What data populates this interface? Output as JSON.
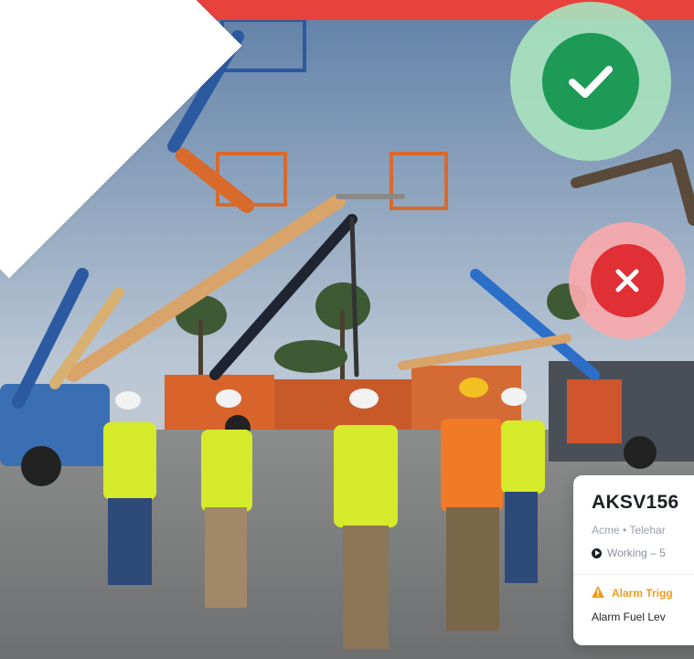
{
  "card": {
    "title": "AKSV156",
    "subtitle": "Acme • Telehar",
    "status": "Working – 5",
    "alarm_title": "Alarm Trigg",
    "alarm_detail": "Alarm Fuel Lev"
  },
  "colors": {
    "brand_red": "#e8423c",
    "success_green": "#1e9a57",
    "error_red": "#e02f35",
    "alarm_orange": "#f29a1c"
  },
  "icons": {
    "ok_badge": "checkmark-icon",
    "fail_badge": "close-icon",
    "status": "play-icon",
    "alarm": "warning-icon"
  }
}
